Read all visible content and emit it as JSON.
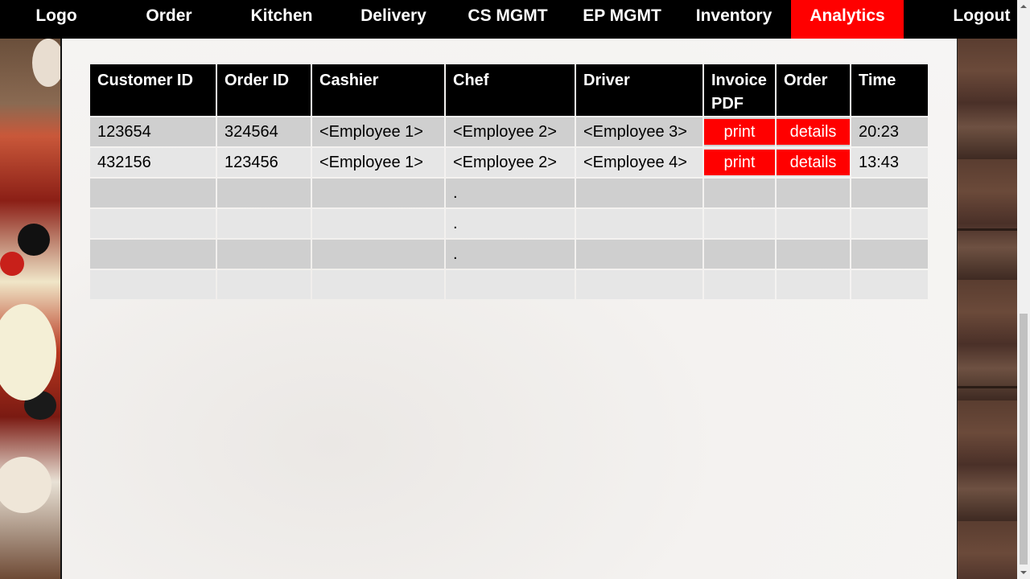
{
  "nav": {
    "items": [
      {
        "label": "Logo",
        "active": false
      },
      {
        "label": "Order",
        "active": false
      },
      {
        "label": "Kitchen",
        "active": false
      },
      {
        "label": "Delivery",
        "active": false
      },
      {
        "label": "CS MGMT",
        "active": false
      },
      {
        "label": "EP MGMT",
        "active": false
      },
      {
        "label": "Inventory",
        "active": false
      },
      {
        "label": "Analytics",
        "active": true
      }
    ],
    "logout_label": "Logout"
  },
  "colors": {
    "accent": "#ff0000",
    "nav_bg": "#000000",
    "row_dark": "#cfcfcf",
    "row_light": "#e6e6e6"
  },
  "table": {
    "headers": {
      "customer_id": "Customer ID",
      "order_id": "Order ID",
      "cashier": "Cashier",
      "chef": "Chef",
      "driver": "Driver",
      "invoice_line1": "Invoice",
      "invoice_line2": "PDF",
      "order": "Order",
      "time": "Time"
    },
    "rows": [
      {
        "customer_id": "123654",
        "order_id": "324564",
        "cashier": "<Employee 1>",
        "chef": "<Employee 2>",
        "driver": "<Employee 3>",
        "invoice": "print",
        "order": "details",
        "time": "20:23"
      },
      {
        "customer_id": "432156",
        "order_id": "123456",
        "cashier": "<Employee 1>",
        "chef": "<Employee 2>",
        "driver": "<Employee 4>",
        "invoice": "print",
        "order": "details",
        "time": "13:43"
      }
    ],
    "ellipsis": [
      ".",
      ".",
      "."
    ]
  }
}
